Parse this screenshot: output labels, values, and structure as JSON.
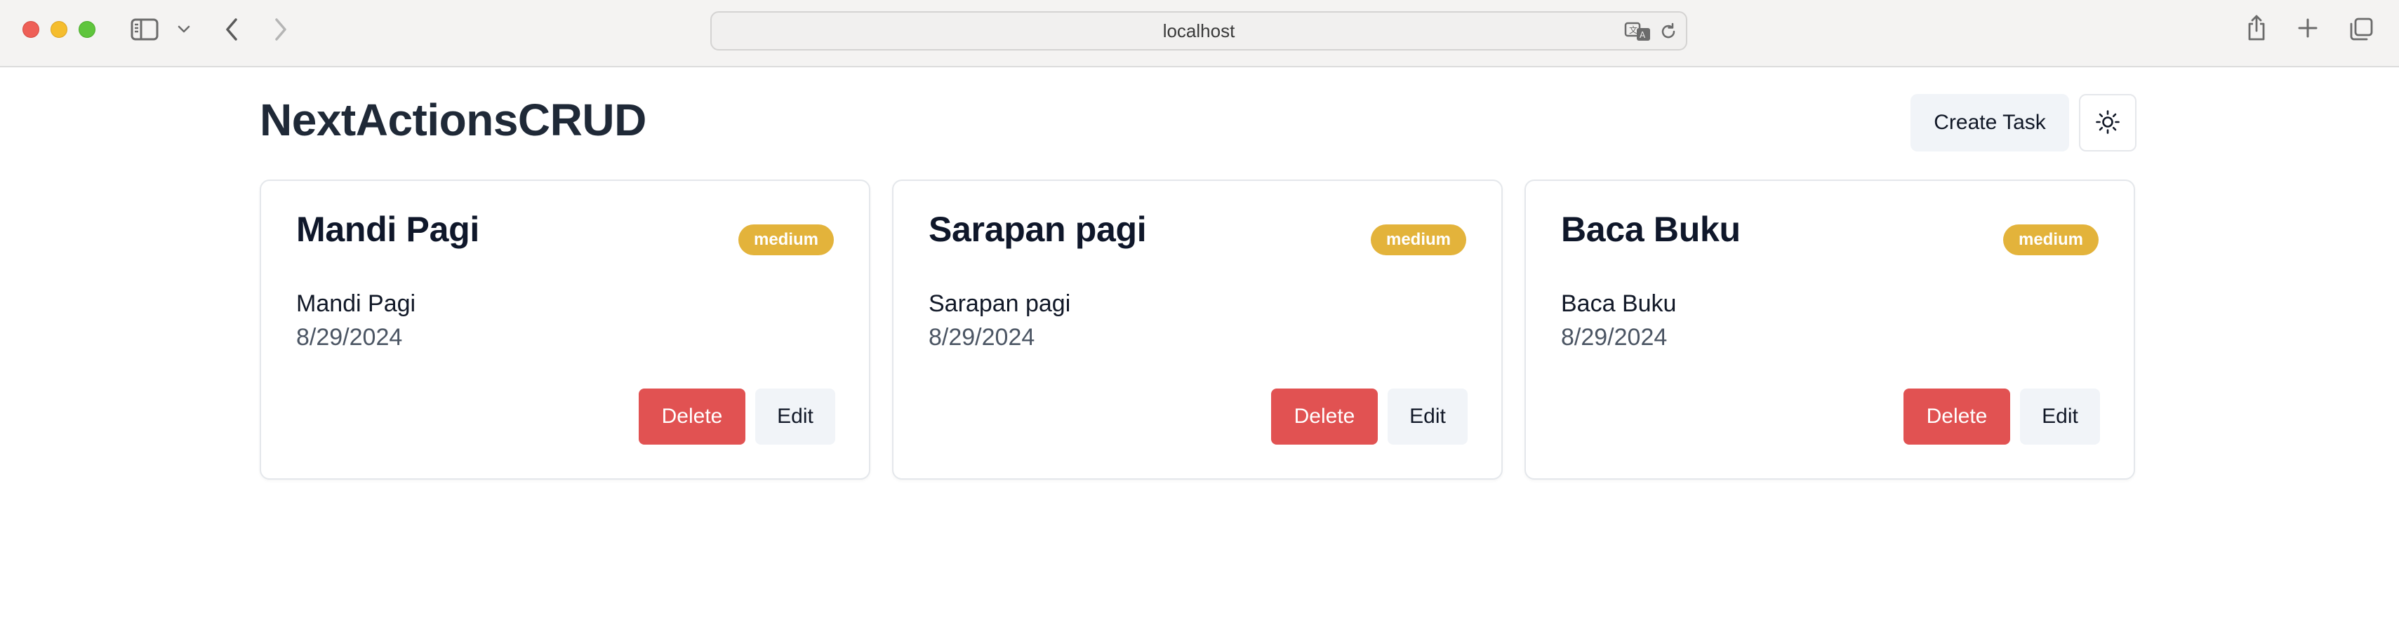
{
  "browser": {
    "url": "localhost",
    "icons": {
      "sidebar": "sidebar-icon",
      "caret": "chevron-down-icon",
      "back": "chevron-left-icon",
      "forward": "chevron-right-icon",
      "translate": "translate-icon",
      "reload": "reload-icon",
      "share": "share-icon",
      "new_tab": "plus-icon",
      "tab_overview": "tabs-icon"
    }
  },
  "header": {
    "title": "NextActionsCRUD",
    "create_label": "Create Task",
    "theme_icon": "sun-icon"
  },
  "colors": {
    "badge_medium": "#e3b33b",
    "delete": "#e15252",
    "secondary_button": "#f1f4f8"
  },
  "tasks": [
    {
      "title": "Mandi Pagi",
      "priority": "medium",
      "description": "Mandi Pagi",
      "date": "8/29/2024",
      "delete_label": "Delete",
      "edit_label": "Edit"
    },
    {
      "title": "Sarapan pagi",
      "priority": "medium",
      "description": "Sarapan pagi",
      "date": "8/29/2024",
      "delete_label": "Delete",
      "edit_label": "Edit"
    },
    {
      "title": "Baca Buku",
      "priority": "medium",
      "description": "Baca Buku",
      "date": "8/29/2024",
      "delete_label": "Delete",
      "edit_label": "Edit"
    }
  ]
}
